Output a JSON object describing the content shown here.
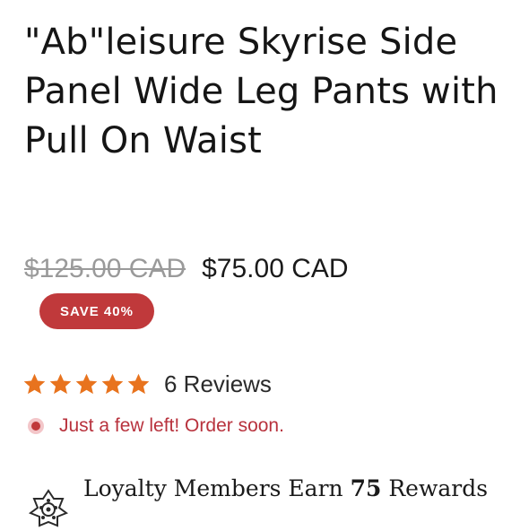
{
  "product": {
    "title": "\"Ab\"leisure Skyrise Side Panel Wide Leg Pants with Pull On Waist",
    "compare_price": "$125.00 CAD",
    "sale_price": "$75.00 CAD",
    "save_badge": "SAVE 40%"
  },
  "rating": {
    "stars": 5,
    "max_stars": 5,
    "reviews_label": "6 Reviews",
    "star_color": "#e8731e"
  },
  "stock": {
    "message": "Just a few left! Order soon.",
    "color": "#b8323d"
  },
  "loyalty": {
    "prefix": "Loyalty Members Earn",
    "points": "75",
    "suffix": "Rewards",
    "icon": "loyalty-emblem-icon"
  },
  "colors": {
    "badge_bg": "#c0393b",
    "compare_price": "#9a9a9a"
  }
}
